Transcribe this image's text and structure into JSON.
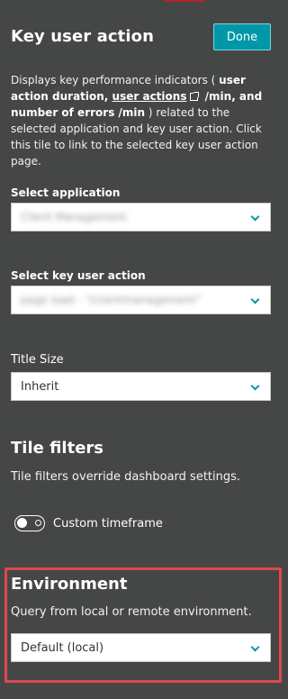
{
  "header": {
    "title": "Key user action",
    "done_label": "Done"
  },
  "description": {
    "part1": "Displays key performance indicators ( ",
    "bold1": "user action duration, ",
    "link": "user actions",
    "bold2": " /min, and number of errors /min",
    "part2": " ) related to the selected application and key user action. Click this tile to link to the selected key user action page."
  },
  "application": {
    "label": "Select application",
    "value": "Client Management"
  },
  "key_user_action": {
    "label": "Select key user action",
    "value": "page load - \"/clientmanagement\""
  },
  "title_size": {
    "label": "Title Size",
    "value": "Inherit"
  },
  "tile_filters": {
    "title": "Tile filters",
    "description": "Tile filters override dashboard settings.",
    "custom_timeframe_label": "Custom timeframe",
    "custom_timeframe_on": false
  },
  "environment": {
    "title": "Environment",
    "description": "Query from local or remote environment.",
    "value": "Default (local)"
  },
  "colors": {
    "panel_bg": "#454646",
    "accent": "#0098a8",
    "highlight_border": "#e0474f"
  }
}
